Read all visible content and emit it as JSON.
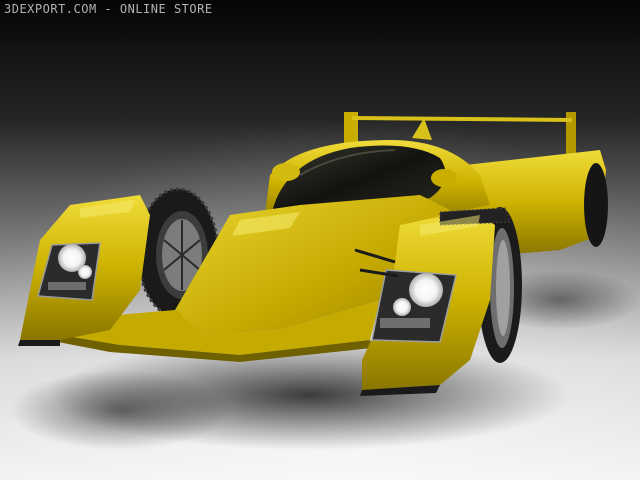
{
  "watermark": {
    "text": "3DEXPORT.COM - ONLINE STORE"
  },
  "scene": {
    "subject": "yellow-prototype-race-car",
    "colors": {
      "body": "#d4b800",
      "body_shadow": "#8a7600",
      "body_highlight": "#f2e24a",
      "canopy": "#1a1a14",
      "tire": "#1c1c1c",
      "rim": "#8a8a8a",
      "floor_light": "#eeeeee",
      "backdrop_dark": "#0a0a0a"
    }
  }
}
